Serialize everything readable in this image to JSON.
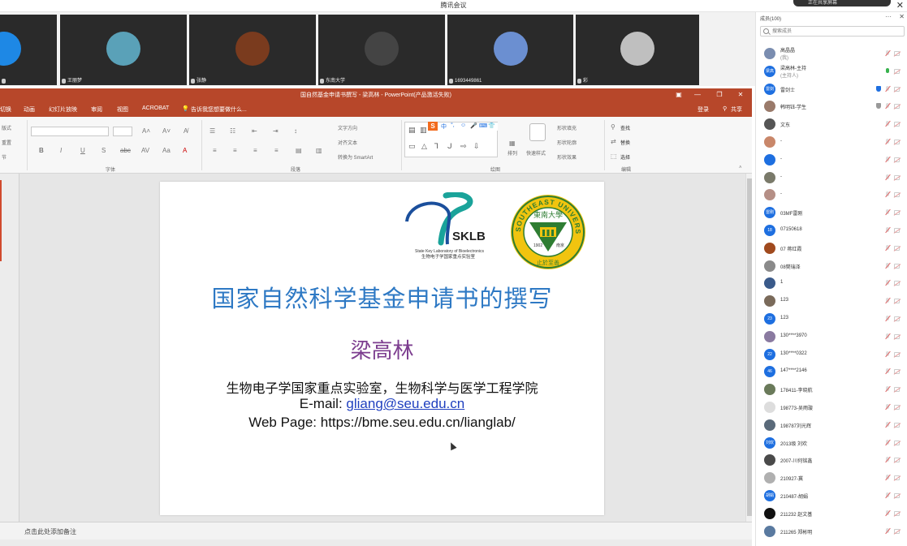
{
  "meeting": {
    "title": "腾讯会议",
    "notification": "正在共享屏幕"
  },
  "video_tiles": [
    {
      "name": "",
      "color": "#1e88e5"
    },
    {
      "name": "王丽梦",
      "color": "#5aa1b8"
    },
    {
      "name": "张静",
      "color": "#7a3b1e"
    },
    {
      "name": "东南大学",
      "color": "#444444"
    },
    {
      "name": "1693449861",
      "color": "#6b8fd1"
    },
    {
      "name": "彩",
      "color": "#bfbfbf"
    }
  ],
  "powerpoint": {
    "doc_title": "国自然基金申请书撰写 - 梁高林 - PowerPoint(产品激活失败)",
    "tabs": [
      "切换",
      "动画",
      "幻灯片放映",
      "审阅",
      "视图",
      "ACROBAT"
    ],
    "tell_me": "告诉我您想要做什么...",
    "sign_in": "登录",
    "share": "共享",
    "ribbon": {
      "left_items": [
        "版式",
        "重置",
        "节"
      ],
      "group_font": "字体",
      "group_paragraph": "段落",
      "group_drawing": "绘图",
      "group_editing": "编辑",
      "text_direction": "文字方向",
      "align_text": "对齐文本",
      "convert_smartart": "转换为 SmartArt",
      "arrange": "排列",
      "quick_styles": "快速样式",
      "shape_fill": "形状填充",
      "shape_outline": "形状轮廓",
      "shape_effects": "形状效果",
      "find": "查找",
      "replace": "替换",
      "select": "选择",
      "font_buttons": [
        "B",
        "I",
        "U",
        "S",
        "abc",
        "AV",
        "Aa",
        "A"
      ],
      "sogou_bar": [
        "中",
        "°,",
        "☺",
        "🎤",
        "⌨",
        "👕",
        "▦"
      ]
    },
    "notes_placeholder": "点击此处添加备注"
  },
  "slide": {
    "title": "国家自然科学基金申请书的撰写",
    "author": "梁高林",
    "affiliation": "生物电子学国家重点实验室，生物科学与医学工程学院",
    "email_label": "E-mail: ",
    "email": "gliang@seu.edu.cn",
    "webpage": "Web Page: https://bme.seu.edu.cn/lianglab/",
    "sklb_logo": {
      "abbr": "SKLB",
      "en": "State Key Laboratory of Bioelectronics",
      "cn": "生物电子学国家重点实验室"
    },
    "seu_logo": {
      "en": "SOUTHEAST UNIVERSITY",
      "cn": "東南大學",
      "year": "1902",
      "city": "南京",
      "motto": "止於至善"
    }
  },
  "panel": {
    "title": "成员(100)",
    "search_placeholder": "搜索成员",
    "members": [
      {
        "name": "高晶晶",
        "sub": "(我)",
        "avatar": "#7a8db0",
        "mic": "muted"
      },
      {
        "name": "梁高林-主持",
        "sub": "(主持人)",
        "avatar": "#1e6fe0",
        "mic": "on",
        "avatar_text": "梁高林"
      },
      {
        "name": "雷剑士",
        "avatar": "#1e6fe0",
        "mic": "muted",
        "badge": "#1e6fe0",
        "avatar_text": "雷剑"
      },
      {
        "name": "韩明钰-学生",
        "avatar": "#9a7a6a",
        "mic": "muted",
        "badge": "#999"
      },
      {
        "name": "文东",
        "avatar": "#555",
        "mic": "muted"
      },
      {
        "name": "-",
        "avatar": "#c9876a",
        "mic": "muted"
      },
      {
        "name": "-",
        "avatar": "#1e6fe0",
        "mic": "muted"
      },
      {
        "name": "-",
        "avatar": "#7a7a6a",
        "mic": "muted"
      },
      {
        "name": "-",
        "avatar": "#b58f86",
        "mic": "muted"
      },
      {
        "name": "03MF雷刚",
        "avatar": "#1e6fe0",
        "mic": "muted",
        "avatar_text": "雷刚"
      },
      {
        "name": "07150618",
        "avatar": "#1e6fe0",
        "mic": "muted",
        "avatar_text": "18"
      },
      {
        "name": "07 蒋红霞",
        "avatar": "#a04a1e",
        "mic": "muted"
      },
      {
        "name": "08樊瑞泽",
        "avatar": "#8a8a8a",
        "mic": "muted"
      },
      {
        "name": "1",
        "avatar": "#3a5a8a",
        "mic": "muted"
      },
      {
        "name": "123",
        "avatar": "#7a6a5a",
        "mic": "muted"
      },
      {
        "name": "123",
        "avatar": "#1e6fe0",
        "mic": "muted",
        "avatar_text": "23"
      },
      {
        "name": "130****3970",
        "avatar": "#8a7aa0",
        "mic": "muted"
      },
      {
        "name": "130****0322",
        "avatar": "#1e6fe0",
        "mic": "muted",
        "avatar_text": "22"
      },
      {
        "name": "147****2146",
        "avatar": "#1e6fe0",
        "mic": "muted",
        "avatar_text": "46"
      },
      {
        "name": "178411-李晓航",
        "avatar": "#6a7a5a",
        "mic": "muted"
      },
      {
        "name": "198773-吴雨璇",
        "avatar": "#dddddd",
        "mic": "muted"
      },
      {
        "name": "198787刘光辉",
        "avatar": "#5a6a7a",
        "mic": "muted"
      },
      {
        "name": "2013级 刘欢",
        "avatar": "#1e6fe0",
        "mic": "muted",
        "avatar_text": "刘欢"
      },
      {
        "name": "2007-川何铭鑫",
        "avatar": "#4a4a4a",
        "mic": "muted"
      },
      {
        "name": "210927-冀",
        "avatar": "#b0b0b0",
        "mic": "muted"
      },
      {
        "name": "210487-胡娟",
        "avatar": "#1e6fe0",
        "mic": "muted",
        "avatar_text": "胡娟"
      },
      {
        "name": "211232 赵文基",
        "avatar": "#111111",
        "mic": "muted"
      },
      {
        "name": "211265 郑彬明",
        "avatar": "#5a7aa0",
        "mic": "muted"
      }
    ]
  }
}
